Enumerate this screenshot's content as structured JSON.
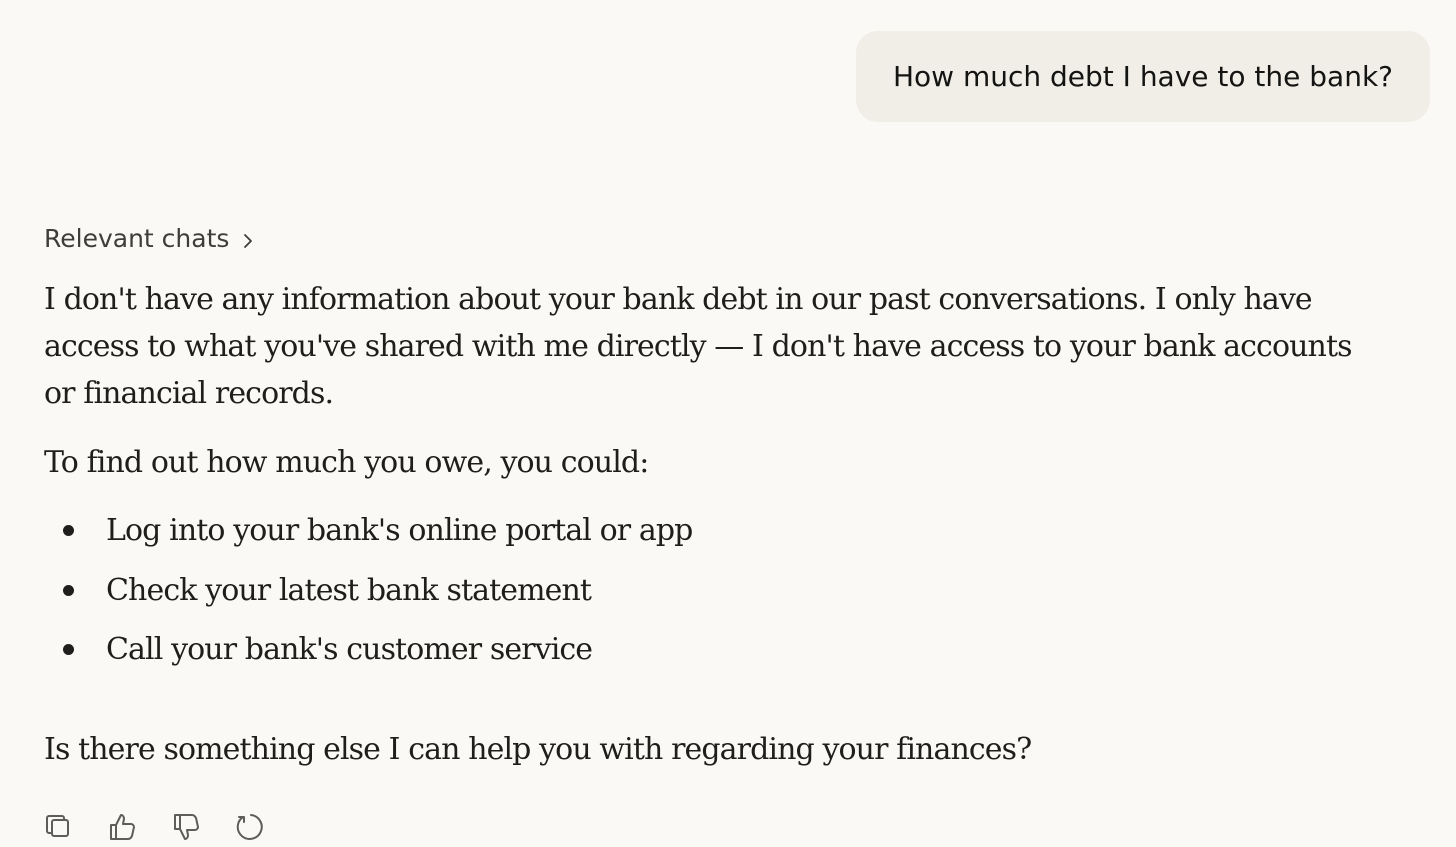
{
  "user_message": {
    "text": "How much debt I have to the bank?"
  },
  "relevant_chats": {
    "label": "Relevant chats",
    "icon": "chevron-right-icon"
  },
  "response": {
    "paragraph_1": "I don't have any information about your bank debt in our past conversations. I only have access to what you've shared with me directly — I don't have access to your bank accounts or financial records.",
    "paragraph_2": "To find out how much you owe, you could:",
    "bullets": [
      "Log into your bank's online portal or app",
      "Check your latest bank statement",
      "Call your bank's customer service"
    ],
    "paragraph_3": "Is there something else I can help you with regarding your finances?"
  },
  "actions": [
    {
      "name": "copy",
      "icon": "copy-icon"
    },
    {
      "name": "thumbs-up",
      "icon": "thumbs-up-icon"
    },
    {
      "name": "thumbs-down",
      "icon": "thumbs-down-icon"
    },
    {
      "name": "retry",
      "icon": "retry-icon"
    }
  ],
  "colors": {
    "background": "#faf9f5",
    "user_bubble": "#f0eee6",
    "text": "#1f1e1d",
    "muted_text": "#3d3d3a",
    "icon": "#5e5d59"
  }
}
